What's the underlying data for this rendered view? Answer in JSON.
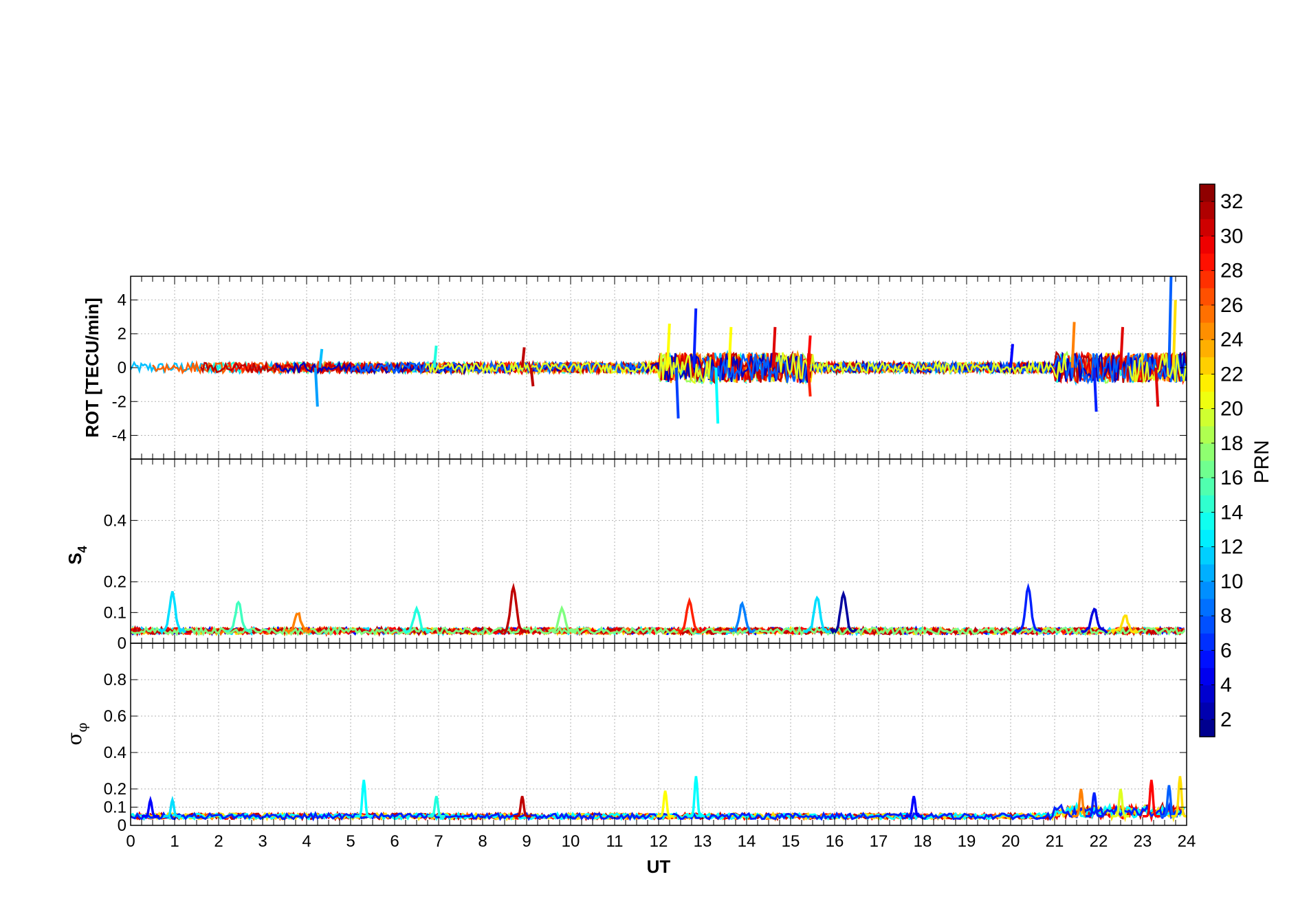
{
  "chart_data": [
    {
      "type": "line",
      "panel": "rot",
      "ylabel": "ROT [TECU/min]",
      "xlim": [
        0,
        24
      ],
      "ylim": [
        -5.4,
        5.4
      ],
      "yticks": [
        "-4",
        "-2",
        "0",
        "2",
        "4"
      ],
      "yticks_values": [
        -4,
        -2,
        0,
        2,
        4
      ],
      "grid": true,
      "baseline_noise": 0.3,
      "events": [
        {
          "x": 4.2,
          "y": -2.3,
          "prn": 10
        },
        {
          "x": 4.3,
          "y": 1.1,
          "prn": 11
        },
        {
          "x": 6.9,
          "y": 1.3,
          "prn": 14
        },
        {
          "x": 8.9,
          "y": 1.2,
          "prn": 31
        },
        {
          "x": 9.1,
          "y": -1.1,
          "prn": 31
        },
        {
          "x": 12.2,
          "y": 2.6,
          "prn": 21
        },
        {
          "x": 12.4,
          "y": -3.0,
          "prn": 7
        },
        {
          "x": 12.8,
          "y": 3.5,
          "prn": 6
        },
        {
          "x": 13.3,
          "y": -3.3,
          "prn": 13
        },
        {
          "x": 13.6,
          "y": 2.4,
          "prn": 21
        },
        {
          "x": 14.6,
          "y": 2.4,
          "prn": 30
        },
        {
          "x": 15.4,
          "y": 1.9,
          "prn": 29
        },
        {
          "x": 15.4,
          "y": -1.7,
          "prn": 28
        },
        {
          "x": 20.0,
          "y": 1.4,
          "prn": 5
        },
        {
          "x": 21.4,
          "y": 2.7,
          "prn": 25
        },
        {
          "x": 21.9,
          "y": -2.6,
          "prn": 6
        },
        {
          "x": 22.5,
          "y": 2.4,
          "prn": 30
        },
        {
          "x": 23.6,
          "y": 5.4,
          "prn": 8
        },
        {
          "x": 23.7,
          "y": 4.0,
          "prn": 22
        },
        {
          "x": 23.3,
          "y": -2.3,
          "prn": 30
        }
      ]
    },
    {
      "type": "line",
      "panel": "s4",
      "ylabel": "S4",
      "xlim": [
        0,
        24
      ],
      "ylim": [
        0,
        0.6
      ],
      "yticks": [
        "0",
        "0.1",
        "0.2",
        "0.4"
      ],
      "yticks_values": [
        0,
        0.1,
        0.2,
        0.4
      ],
      "grid": true,
      "baseline": 0.04,
      "peaks": [
        {
          "x": 0.95,
          "y": 0.165,
          "prn": 12
        },
        {
          "x": 2.45,
          "y": 0.135,
          "prn": 15
        },
        {
          "x": 3.8,
          "y": 0.1,
          "prn": 25
        },
        {
          "x": 6.5,
          "y": 0.11,
          "prn": 14
        },
        {
          "x": 8.7,
          "y": 0.185,
          "prn": 31
        },
        {
          "x": 9.8,
          "y": 0.115,
          "prn": 17
        },
        {
          "x": 12.7,
          "y": 0.135,
          "prn": 28
        },
        {
          "x": 13.9,
          "y": 0.13,
          "prn": 9
        },
        {
          "x": 15.6,
          "y": 0.15,
          "prn": 12
        },
        {
          "x": 16.2,
          "y": 0.165,
          "prn": 2
        },
        {
          "x": 20.4,
          "y": 0.18,
          "prn": 6
        },
        {
          "x": 21.9,
          "y": 0.115,
          "prn": 4
        },
        {
          "x": 22.6,
          "y": 0.09,
          "prn": 22
        }
      ]
    },
    {
      "type": "line",
      "panel": "sigma_phi",
      "ylabel": "σφ",
      "xlim": [
        0,
        24
      ],
      "ylim": [
        0,
        1.0
      ],
      "yticks": [
        "0",
        "0.1",
        "0.2",
        "0.4",
        "0.6",
        "0.8"
      ],
      "yticks_values": [
        0,
        0.1,
        0.2,
        0.4,
        0.6,
        0.8
      ],
      "grid": true,
      "baseline": 0.05,
      "xlabel": "UT",
      "xticks": [
        "0",
        "1",
        "2",
        "3",
        "4",
        "5",
        "6",
        "7",
        "8",
        "9",
        "10",
        "11",
        "12",
        "13",
        "14",
        "15",
        "16",
        "17",
        "18",
        "19",
        "20",
        "21",
        "22",
        "23",
        "24"
      ],
      "peaks": [
        {
          "x": 0.45,
          "y": 0.14,
          "prn": 5
        },
        {
          "x": 0.95,
          "y": 0.14,
          "prn": 12
        },
        {
          "x": 5.3,
          "y": 0.25,
          "prn": 13
        },
        {
          "x": 6.95,
          "y": 0.16,
          "prn": 14
        },
        {
          "x": 8.9,
          "y": 0.16,
          "prn": 31
        },
        {
          "x": 12.15,
          "y": 0.19,
          "prn": 21
        },
        {
          "x": 12.85,
          "y": 0.27,
          "prn": 13
        },
        {
          "x": 17.8,
          "y": 0.16,
          "prn": 5
        },
        {
          "x": 21.6,
          "y": 0.2,
          "prn": 25
        },
        {
          "x": 21.9,
          "y": 0.18,
          "prn": 6
        },
        {
          "x": 22.5,
          "y": 0.2,
          "prn": 20
        },
        {
          "x": 23.2,
          "y": 0.25,
          "prn": 29
        },
        {
          "x": 23.6,
          "y": 0.22,
          "prn": 8
        },
        {
          "x": 23.85,
          "y": 0.27,
          "prn": 22
        }
      ]
    }
  ],
  "colorbar": {
    "label": "PRN",
    "min": 1,
    "max": 33,
    "ticks": [
      "2",
      "4",
      "6",
      "8",
      "10",
      "12",
      "14",
      "16",
      "18",
      "20",
      "22",
      "24",
      "26",
      "28",
      "30",
      "32"
    ],
    "ticks_values": [
      2,
      4,
      6,
      8,
      10,
      12,
      14,
      16,
      18,
      20,
      22,
      24,
      26,
      28,
      30,
      32
    ],
    "colormap": "jet"
  },
  "labels": {
    "rot_ylabel": "ROT [TECU/min]",
    "s4_ylabel_main": "S",
    "s4_ylabel_sub": "4",
    "sigma_main": "σ",
    "sigma_sub": "φ",
    "xlabel": "UT",
    "cb_label": "PRN"
  }
}
